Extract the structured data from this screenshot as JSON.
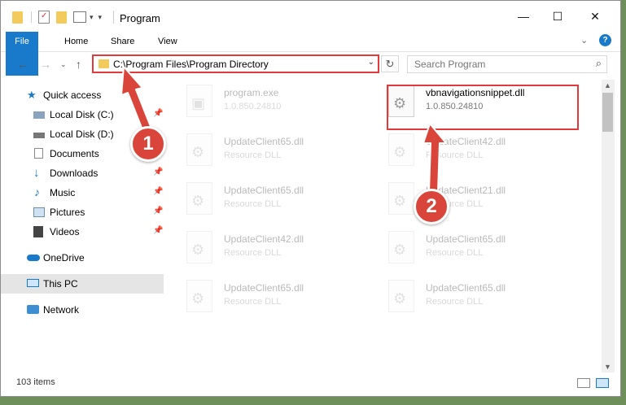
{
  "window": {
    "title": "Program",
    "minimize_glyph": "—",
    "maximize_glyph": "☐",
    "close_glyph": "✕"
  },
  "ribbon": {
    "tabs": [
      "File",
      "Home",
      "Share",
      "View"
    ]
  },
  "navigation": {
    "address_path": "C:\\Program Files\\Program Directory",
    "search_placeholder": "Search Program"
  },
  "sidebar": {
    "items": [
      {
        "label": "Quick access",
        "icon": "star-icon",
        "pinned": false
      },
      {
        "label": "Local Disk (C:)",
        "icon": "drive-icon",
        "pinned": true
      },
      {
        "label": "Local Disk (D:)",
        "icon": "drive-icon",
        "pinned": false
      },
      {
        "label": "Documents",
        "icon": "document-icon",
        "pinned": true
      },
      {
        "label": "Downloads",
        "icon": "download-icon",
        "pinned": true
      },
      {
        "label": "Music",
        "icon": "music-icon",
        "pinned": true
      },
      {
        "label": "Pictures",
        "icon": "pictures-icon",
        "pinned": true
      },
      {
        "label": "Videos",
        "icon": "videos-icon",
        "pinned": true
      },
      {
        "label": "OneDrive",
        "icon": "cloud-icon",
        "pinned": false
      },
      {
        "label": "This PC",
        "icon": "computer-icon",
        "pinned": false,
        "selected": true
      },
      {
        "label": "Network",
        "icon": "network-icon",
        "pinned": false
      }
    ]
  },
  "files": [
    {
      "name": "program.exe",
      "sub": "1.0.850.24810",
      "faded": true
    },
    {
      "name": "vbnavigationsnippet.dll",
      "sub": "1.0.850.24810",
      "faded": false,
      "highlighted": true
    },
    {
      "name": "UpdateClient65.dll",
      "sub": "Resource DLL",
      "faded": true
    },
    {
      "name": "UpdateClient42.dll",
      "sub": "Resource DLL",
      "faded": true
    },
    {
      "name": "UpdateClient65.dll",
      "sub": "Resource DLL",
      "faded": true
    },
    {
      "name": "UpdateClient21.dll",
      "sub": "Resource DLL",
      "faded": true
    },
    {
      "name": "UpdateClient42.dll",
      "sub": "Resource DLL",
      "faded": true
    },
    {
      "name": "UpdateClient65.dll",
      "sub": "Resource DLL",
      "faded": true
    },
    {
      "name": "UpdateClient65.dll",
      "sub": "Resource DLL",
      "faded": true
    },
    {
      "name": "UpdateClient65.dll",
      "sub": "Resource DLL",
      "faded": true
    }
  ],
  "status": {
    "item_count": "103 items"
  },
  "annotations": {
    "step1": "1",
    "step2": "2",
    "accent_color": "#d9453a"
  }
}
